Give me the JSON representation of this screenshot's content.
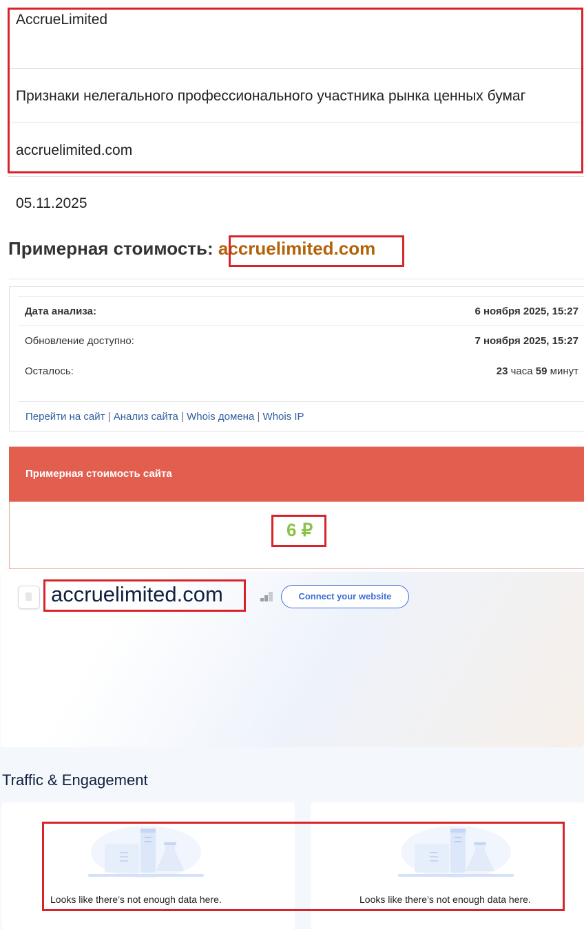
{
  "info_table": {
    "name": "AccrueLimited",
    "description": "Признаки нелегального профессионального участника рынка ценных бумаг",
    "domain": "accruelimited.com"
  },
  "date": "05.11.2025",
  "cost_title": {
    "prefix": "Примерная стоимость:",
    "domain": "accruelimited.com"
  },
  "analysis": {
    "rows": [
      {
        "label": "Дата анализа:",
        "value": "6 ноября 2025, 15:27"
      },
      {
        "label": "Обновление доступно:",
        "value": "7 ноября 2025, 15:27"
      }
    ],
    "remaining": {
      "label": "Осталось:",
      "hours": "23",
      "hours_unit": "часа",
      "minutes": "59",
      "minutes_unit": "минут"
    },
    "links": [
      {
        "label": "Перейти на сайт"
      },
      {
        "label": "Анализ сайта"
      },
      {
        "label": "Whois домена"
      },
      {
        "label": "Whois IP"
      }
    ],
    "link_separator": "|"
  },
  "site_cost": {
    "header": "Примерная стоимость сайта",
    "value": "6 ₽"
  },
  "similarweb": {
    "domain": "accruelimited.com",
    "connect_button": "Connect your website",
    "section_title": "Traffic & Engagement",
    "cards": [
      {
        "empty_text": "Looks like there’s not enough data here."
      },
      {
        "empty_text": "Looks like there’s not enough data here."
      }
    ]
  },
  "colors": {
    "highlight_box": "#d8232a",
    "cost_header": "#e25f50",
    "cost_value": "#8bc34a",
    "title_domain": "#b4620a",
    "connect_button": "#3d6fd6"
  }
}
